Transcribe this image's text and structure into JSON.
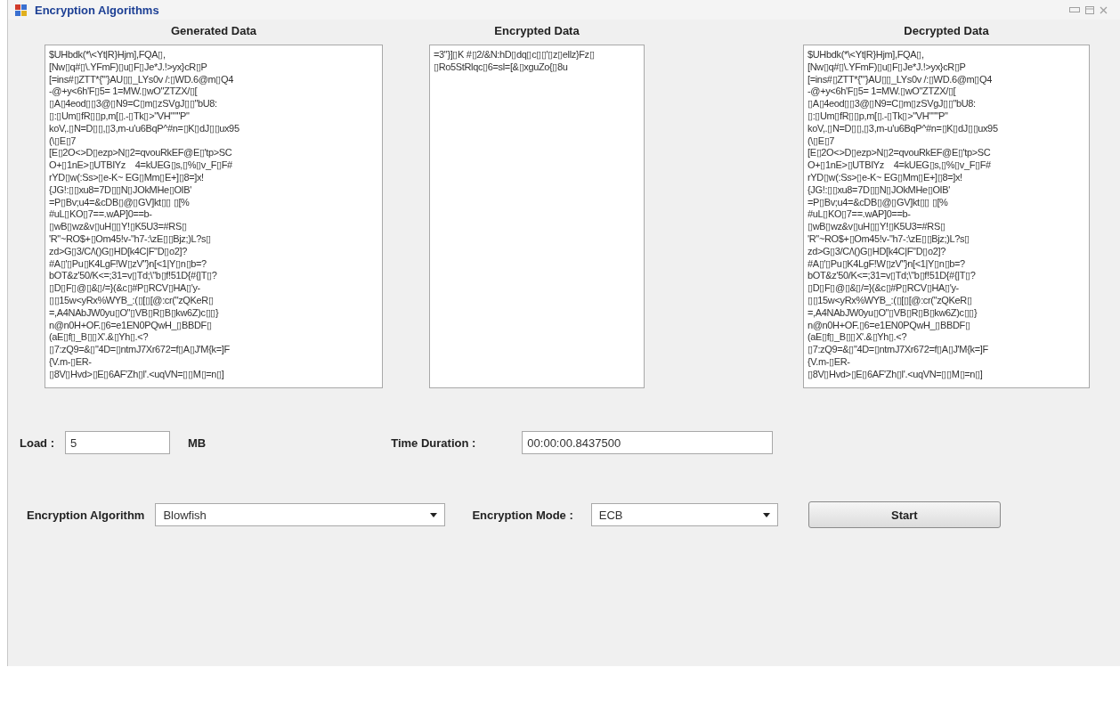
{
  "window": {
    "title": "Encryption Algorithms"
  },
  "panels": [
    {
      "heading": "Generated Data",
      "text": "$UHbdk(*\\<Yt|R}Hjm],FQA▯,\n[Nw▯q#▯\\.YFmF)▯u▯F▯Je*J.!>yx}cR▯P\n[=ins#▯ZTT*{'\"}AU▯▯_LYs0v /:▯WD.6@m▯Q4\n-@+y<6h'F▯5= 1=MW.▯wO\"ZTZX/▯[\n▯A▯4eod▯▯3@▯N9=C▯m▯zSVgJ▯▯\"bU8:\n▯:▯Um▯fR▯▯p,m[▯.-▯Tk▯>\"VH\"\"\"P\"\nkoV,.▯N=D▯▯,▯3,m-u'u6BqP^#n=▯K▯dJ▯▯ux95\n(\\▯E▯7\n[E▯2O<>D▯ezp>N▯2=qvouRkEF@E▯'tp>SC\nO+▯1nE>▯UTBIYz    4=kUEG▯s,▯%▯v_F▯F#\nrYD▯w(:Ss>▯e-K~ EG▯Mm▯E+]▯8=]x!\n{JG!:▯▯xu8=7D▯▯N▯JOkMHe▯OIB'\n=P▯Bv;u4=&cDB▯@▯GV]kt▯▯ ▯[%\n#uL▯KO▯7==.wAP]0==b-\n▯wB▯wz&v▯uH▯▯Y!▯K5U3=#RS▯\n'R\"~RO$+▯Om45!v-\"h7-:\\zE▯▯Bjz;)L?s▯\nzd>G▯3/C/\\()G▯HD[k4C|F\"D▯o2]?\n#A▯'▯Pu▯K4LgF!W▯zV\"}n[<1|Y▯n▯b=?\nbOT&z'50/K<=;31=v▯Td;\\\"b▯f!51D{#{|T▯?\n▯D▯F▯@▯&▯/=}(&c▯#P▯RCV▯HA▯'y-\n▯▯15w<yRx%WYB_:(▯[▯[@:cr(\"zQKeR▯\n=,A4NAbJW0yu▯O\"▯VB▯R▯B▯kw6Z)c▯▯}\nn@n0H+OF.▯6=e1EN0PQwH_▯BBDF▯\n(aE▯f▯_B▯▯X'.&▯Yh▯.<?\n▯7:zQ9=&▯\"4D=▯ntmJ7Xr672=f▯A▯J'M{k=]F\n{V.m-▯ER-\n▯8V▯Hvd>▯E▯6AF'Zh▯l'.<uqVN=▯▯M▯=n▯]"
    },
    {
      "heading": "Encrypted Data",
      "text": "=3\"}]▯K #▯2/&N:hD▯dq▯c▯▯'▯z▯ellz}Fz▯\n▯Ro5StRlqc▯6=sl=[&▯xguZo{▯8u"
    },
    {
      "heading": "Decrypted Data",
      "text": "$UHbdk(*\\<Yt|R}Hjm],FQA▯,\n[Nw▯q#▯\\.YFmF)▯u▯F▯Je*J.!>yx}cR▯P\n[=ins#▯ZTT*{'\"}AU▯▯_LYs0v /:▯WD.6@m▯Q4\n-@+y<6h'F▯5= 1=MW.▯wO\"ZTZX/▯[\n▯A▯4eod▯▯3@▯N9=C▯m▯zSVgJ▯▯\"bU8:\n▯:▯Um▯fR▯▯p,m[▯.-▯Tk▯>\"VH\"\"\"P\"\nkoV,.▯N=D▯▯,▯3,m-u'u6BqP^#n=▯K▯dJ▯▯ux95\n(\\▯E▯7\n[E▯2O<>D▯ezp>N▯2=qvouRkEF@E▯'tp>SC\nO+▯1nE>▯UTBIYz    4=kUEG▯s,▯%▯v_F▯F#\nrYD▯w(:Ss>▯e-K~ EG▯Mm▯E+]▯8=]x!\n{JG!:▯▯xu8=7D▯▯N▯JOkMHe▯OIB'\n=P▯Bv;u4=&cDB▯@▯GV]kt▯▯ ▯[%\n#uL▯KO▯7==.wAP]0==b-\n▯wB▯wz&v▯uH▯▯Y!▯K5U3=#RS▯\n'R\"~RO$+▯Om45!v-\"h7-:\\zE▯▯Bjz;)L?s▯\nzd>G▯3/C/\\()G▯HD[k4C|F\"D▯o2]?\n#A▯'▯Pu▯K4LgF!W▯zV\"}n[<1|Y▯n▯b=?\nbOT&z'50/K<=;31=v▯Td;\\\"b▯f!51D{#{|T▯?\n▯D▯F▯@▯&▯/=}(&c▯#P▯RCV▯HA▯'y-\n▯▯15w<yRx%WYB_:(▯[▯[@:cr(\"zQKeR▯\n=,A4NAbJW0yu▯O\"▯VB▯R▯B▯kw6Z)c▯▯}\nn@n0H+OF.▯6=e1EN0PQwH_▯BBDF▯\n(aE▯f▯_B▯▯X'.&▯Yh▯.<?\n▯7:zQ9=&▯\"4D=▯ntmJ7Xr672=f▯A▯J'M{k=]F\n{V.m-▯ER-\n▯8V▯Hvd>▯E▯6AF'Zh▯l'.<uqVN=▯▯M▯=n▯]"
    }
  ],
  "load": {
    "label": "Load :",
    "value": "5",
    "unit": "MB"
  },
  "time_duration": {
    "label": "Time Duration :",
    "value": "00:00:00.8437500"
  },
  "encryption_algorithm": {
    "label": "Encryption Algorithm",
    "value": "Blowfish"
  },
  "encryption_mode": {
    "label": "Encryption Mode :",
    "value": "ECB"
  },
  "start_button": "Start"
}
